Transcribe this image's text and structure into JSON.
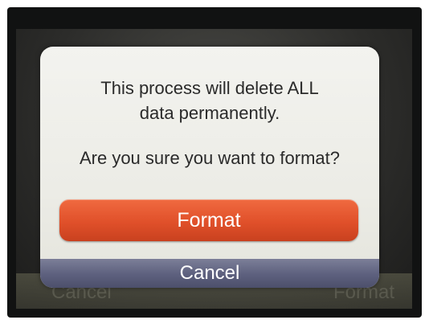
{
  "dialog": {
    "message_lines": [
      "This process will delete ALL",
      "data permanently."
    ],
    "question": "Are you sure you want to format?",
    "format_label": "Format",
    "cancel_label": "Cancel"
  },
  "background": {
    "left_label": "Cancel",
    "right_label": "Format"
  },
  "colors": {
    "format_button": "#e0502a",
    "cancel_bar": "#5f6280",
    "dialog_bg": "#ecece6"
  }
}
